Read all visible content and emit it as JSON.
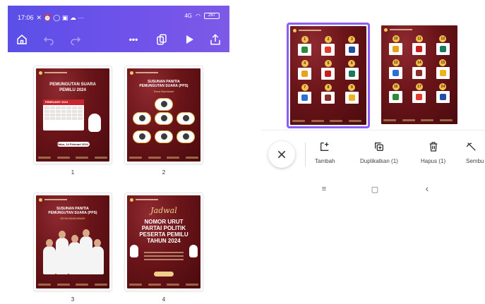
{
  "left_screen": {
    "status_time": "17:06",
    "status_signal": "4G",
    "status_battery": "287",
    "toolbar": {
      "home_icon": "home-icon",
      "undo_icon": "undo-icon",
      "redo_icon": "redo-icon",
      "more_label": "•••",
      "pages_icon": "pages-icon",
      "play_icon": "play-icon",
      "share_icon": "share-icon"
    },
    "pages": [
      {
        "number": "1",
        "title_line1": "PEMUNGUTAN SUARA",
        "title_line2": "PEMILU 2024",
        "month": "FEBRUARY",
        "year": "2024",
        "note": "Rabu, 14 Februari 2024"
      },
      {
        "number": "2",
        "title_line1": "SUSUNAN PANITIA",
        "title_line2": "PEMUNGUTAN SUARA (PPS)",
        "subtitle": "Desa Bandabari"
      },
      {
        "number": "3",
        "title_line1": "SUSUNAN PANITIA",
        "title_line2": "PEMUNGUTAN SUARA (PPS)",
        "subtitle": "DESA BANDABARI"
      },
      {
        "number": "4",
        "script_title": "Jadwal",
        "title_line1": "NOMOR URUT",
        "title_line2": "PARTAI POLITIK",
        "title_line3": "PESERTA PEMILU",
        "title_line4": "TAHUN 2024"
      }
    ]
  },
  "right_screen": {
    "page_a_numbers": [
      "1",
      "2",
      "3",
      "4",
      "5",
      "6",
      "7",
      "8",
      "9"
    ],
    "page_b_numbers": [
      "10",
      "11",
      "12",
      "13",
      "14",
      "15",
      "16",
      "17",
      "24"
    ],
    "actions": {
      "close_icon": "close-icon",
      "tambah": "Tambah",
      "duplikatkan": "Duplikatkan (1)",
      "hapus": "Hapus (1)",
      "sembunyikan": "Sembu"
    },
    "nav": {
      "recents": "≡",
      "home": "▢",
      "back": "‹"
    }
  },
  "colors": {
    "topbar_start": "#5a4fe8",
    "topbar_end": "#7d5ae8",
    "slide_red": "#6a1418",
    "selection": "#8b5cf6",
    "badge_gold": "#f1c24b"
  }
}
